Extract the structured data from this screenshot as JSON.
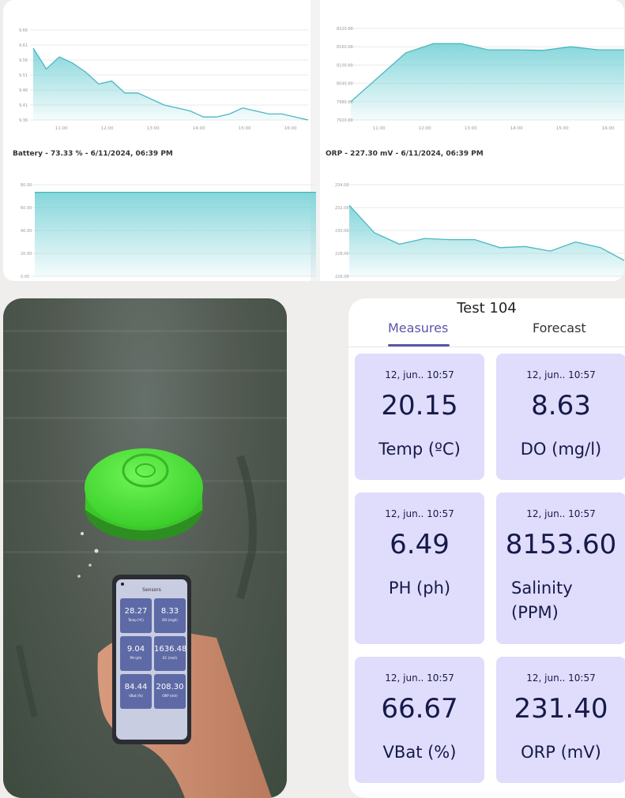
{
  "dashboard": {
    "panels": [
      {
        "title": "",
        "yticks": [
          "9.66",
          "9.61",
          "9.56",
          "9.51",
          "9.46",
          "9.41",
          "9.36"
        ],
        "xticks": [
          "11:00",
          "12:00",
          "13:00",
          "14:00",
          "15:00",
          "16:00"
        ]
      },
      {
        "title": "",
        "yticks": [
          "8220.00",
          "8160.00",
          "8100.00",
          "8040.00",
          "7980.00",
          "7920.00"
        ],
        "xticks": [
          "11:00",
          "12:00",
          "13:00",
          "14:00",
          "15:00",
          "16:00"
        ]
      },
      {
        "title": "Battery - 73.33 % - 6/11/2024, 06:39 PM",
        "yticks": [
          "80.00",
          "60.00",
          "40.00",
          "20.00",
          "0.00"
        ],
        "xticks": []
      },
      {
        "title": "ORP - 227.30 mV - 6/11/2024, 06:39 PM",
        "yticks": [
          "234.00",
          "232.00",
          "230.00",
          "228.00",
          "226.00"
        ],
        "xticks": []
      }
    ]
  },
  "chart_data": [
    {
      "type": "area",
      "ylim": [
        9.36,
        9.66
      ],
      "x": [
        0,
        1,
        2,
        3,
        4,
        5,
        6,
        7,
        8,
        9,
        10,
        11,
        12,
        13,
        14,
        15,
        16,
        17,
        18,
        19,
        20,
        21
      ],
      "values": [
        9.6,
        9.53,
        9.57,
        9.55,
        9.52,
        9.48,
        9.49,
        9.45,
        9.45,
        9.43,
        9.41,
        9.4,
        9.39,
        9.37,
        9.37,
        9.38,
        9.4,
        9.39,
        9.38,
        9.38,
        9.37,
        9.36
      ]
    },
    {
      "type": "area",
      "ylim": [
        7920,
        8220
      ],
      "x": [
        0,
        1,
        2,
        3,
        4,
        5,
        6,
        7,
        8,
        9,
        10
      ],
      "values": [
        7980,
        8060,
        8140,
        8170,
        8170,
        8150,
        8150,
        8148,
        8160,
        8150,
        8150
      ]
    },
    {
      "type": "area",
      "ylim": [
        0,
        80
      ],
      "x": [
        0,
        1
      ],
      "values": [
        73.33,
        73.33
      ]
    },
    {
      "type": "area",
      "ylim": [
        226,
        234
      ],
      "x": [
        0,
        1,
        2,
        3,
        4,
        5,
        6,
        7,
        8,
        9,
        10,
        11
      ],
      "values": [
        232.2,
        229.8,
        228.8,
        229.3,
        229.2,
        229.2,
        228.5,
        228.6,
        228.2,
        229.0,
        228.5,
        227.3
      ]
    }
  ],
  "phone_screen": {
    "title": "Sensors",
    "readings": [
      {
        "value": "28.27",
        "label": "Temp (ºC)"
      },
      {
        "value": "8.33",
        "label": "DO (mg/l)"
      },
      {
        "value": "9.04",
        "label": "PH (ph)"
      },
      {
        "value": "1636.48",
        "label": "EC (ms/l)"
      },
      {
        "value": "84.44",
        "label": "VBat (%)"
      },
      {
        "value": "208.30",
        "label": "ORP (mV)"
      }
    ]
  },
  "app": {
    "title": "Test 104",
    "tabs": [
      "Measures",
      "Forecast"
    ],
    "cards": [
      {
        "timestamp": "12, jun.. 10:57",
        "value": "20.15",
        "label": "Temp (ºC)"
      },
      {
        "timestamp": "12, jun.. 10:57",
        "value": "8.63",
        "label": "DO (mg/l)"
      },
      {
        "timestamp": "12, jun.. 10:57",
        "value": "6.49",
        "label": "PH (ph)"
      },
      {
        "timestamp": "12, jun.. 10:57",
        "value": "8153.60",
        "label_line1": "Salinity",
        "label_line2": "(PPM)"
      },
      {
        "timestamp": "12, jun.. 10:57",
        "value": "66.67",
        "label": "VBat (%)"
      },
      {
        "timestamp": "12, jun.. 10:57",
        "value": "231.40",
        "label": "ORP (mV)"
      }
    ]
  },
  "colors": {
    "accent": "#5a55a8",
    "card": "#e0dcfb",
    "area_top": "#7fd4d9",
    "area_line": "#4ab8c0",
    "buoy": "#4fe03a"
  }
}
